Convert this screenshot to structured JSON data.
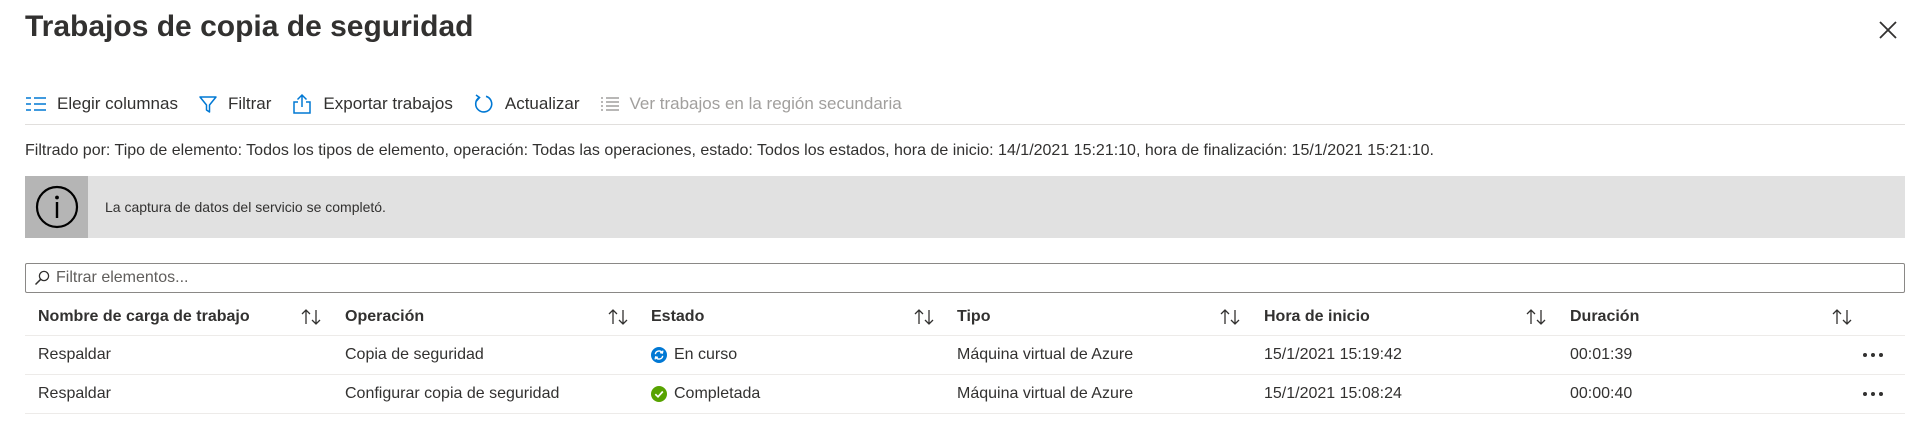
{
  "page": {
    "title": "Trabajos de copia de seguridad"
  },
  "toolbar": {
    "choose_columns": "Elegir columnas",
    "filter": "Filtrar",
    "export_jobs": "Exportar trabajos",
    "refresh": "Actualizar",
    "secondary_region": "Ver trabajos en la región secundaria"
  },
  "filter_summary": "Filtrado por: Tipo de elemento: Todos los tipos de elemento, operación: Todas las operaciones, estado: Todos los estados, hora de inicio: 14/1/2021 15:21:10, hora de finalización: 15/1/2021 15:21:10.",
  "info_banner": {
    "message": "La captura de datos del servicio se completó."
  },
  "search": {
    "placeholder": "Filtrar elementos..."
  },
  "table": {
    "columns": [
      "Nombre de carga de trabajo",
      "Operación",
      "Estado",
      "Tipo",
      "Hora de inicio",
      "Duración"
    ],
    "rows": [
      {
        "workload": "Respaldar",
        "operation": "Copia de seguridad",
        "status": "En curso",
        "status_icon": "in-progress-icon",
        "type": "Máquina virtual de Azure",
        "start": "15/1/2021 15:19:42",
        "duration": "00:01:39"
      },
      {
        "workload": "Respaldar",
        "operation": "Configurar copia de seguridad",
        "status": "Completada",
        "status_icon": "success-check-icon",
        "type": "Máquina virtual de Azure",
        "start": "15/1/2021 15:08:24",
        "duration": "00:00:40"
      }
    ]
  },
  "colors": {
    "accent": "#0078d4",
    "success": "#57a300",
    "info_bg": "#e1e1e1",
    "info_icon_bg": "#b5b5b5"
  }
}
